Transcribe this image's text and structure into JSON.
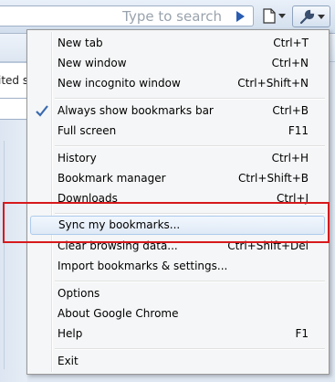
{
  "toolbar": {
    "search_placeholder": "Type to search"
  },
  "background": {
    "partial_text": "ited s"
  },
  "menu": {
    "items": [
      {
        "label": "New tab",
        "shortcut": "Ctrl+T"
      },
      {
        "label": "New window",
        "shortcut": "Ctrl+N"
      },
      {
        "label": "New incognito window",
        "shortcut": "Ctrl+Shift+N"
      },
      {
        "label": "Always show bookmarks bar",
        "shortcut": "Ctrl+B",
        "checked": true
      },
      {
        "label": "Full screen",
        "shortcut": "F11"
      },
      {
        "label": "History",
        "shortcut": "Ctrl+H"
      },
      {
        "label": "Bookmark manager",
        "shortcut": "Ctrl+Shift+B"
      },
      {
        "label": "Downloads",
        "shortcut": "Ctrl+J"
      },
      {
        "label": "Sync my bookmarks...",
        "shortcut": ""
      },
      {
        "label": "Clear browsing data...",
        "shortcut": "Ctrl+Shift+Del"
      },
      {
        "label": "Import bookmarks & settings...",
        "shortcut": ""
      },
      {
        "label": "Options",
        "shortcut": ""
      },
      {
        "label": "About Google Chrome",
        "shortcut": ""
      },
      {
        "label": "Help",
        "shortcut": "F1"
      },
      {
        "label": "Exit",
        "shortcut": ""
      }
    ]
  },
  "icons": {
    "go": "play-arrow-icon",
    "page_menu": "page-icon",
    "wrench_menu": "wrench-icon",
    "check": "checkmark-icon"
  },
  "colors": {
    "highlight_border": "#aecbed",
    "annotation": "#d7191c",
    "check": "#3a6ab0"
  }
}
